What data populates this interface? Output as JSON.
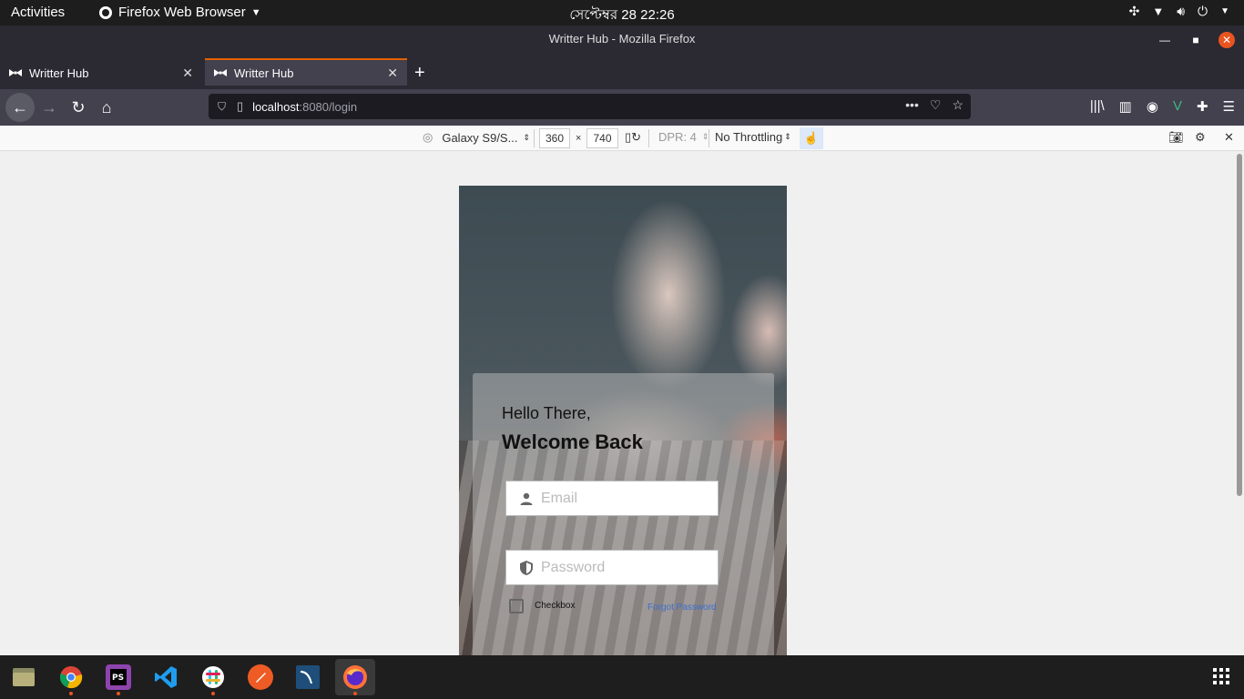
{
  "topbar": {
    "activities": "Activities",
    "app_name": "Firefox Web Browser",
    "clock": "সেপ্টেম্বর 28  22:26"
  },
  "window": {
    "title": "Writter Hub - Mozilla Firefox"
  },
  "tabs": [
    {
      "title": "Writter Hub",
      "active": false
    },
    {
      "title": "Writter Hub",
      "active": true
    }
  ],
  "navbar": {
    "url_host": "localhost",
    "url_path": ":8080/login"
  },
  "rdm": {
    "device": "Galaxy S9/S...",
    "width": "360",
    "times": "×",
    "height": "740",
    "dpr": "DPR: 4",
    "throttling": "No Throttling"
  },
  "login": {
    "greeting": "Hello There,",
    "welcome": "Welcome Back",
    "email_placeholder": "Email",
    "password_placeholder": "Password",
    "checkbox_label": "Checkbox",
    "forgot_label": "Forgot Password"
  },
  "colors": {
    "accent": "#e95420",
    "link": "#3b6fd1",
    "firefox_dark": "#2b2a33",
    "firefox_toolbar": "#42414d"
  },
  "dock": {
    "apps": [
      "files-icon",
      "chrome-icon",
      "phpstorm-icon",
      "vscode-icon",
      "slack-icon",
      "postman-icon",
      "mysql-workbench-icon",
      "firefox-icon"
    ]
  }
}
